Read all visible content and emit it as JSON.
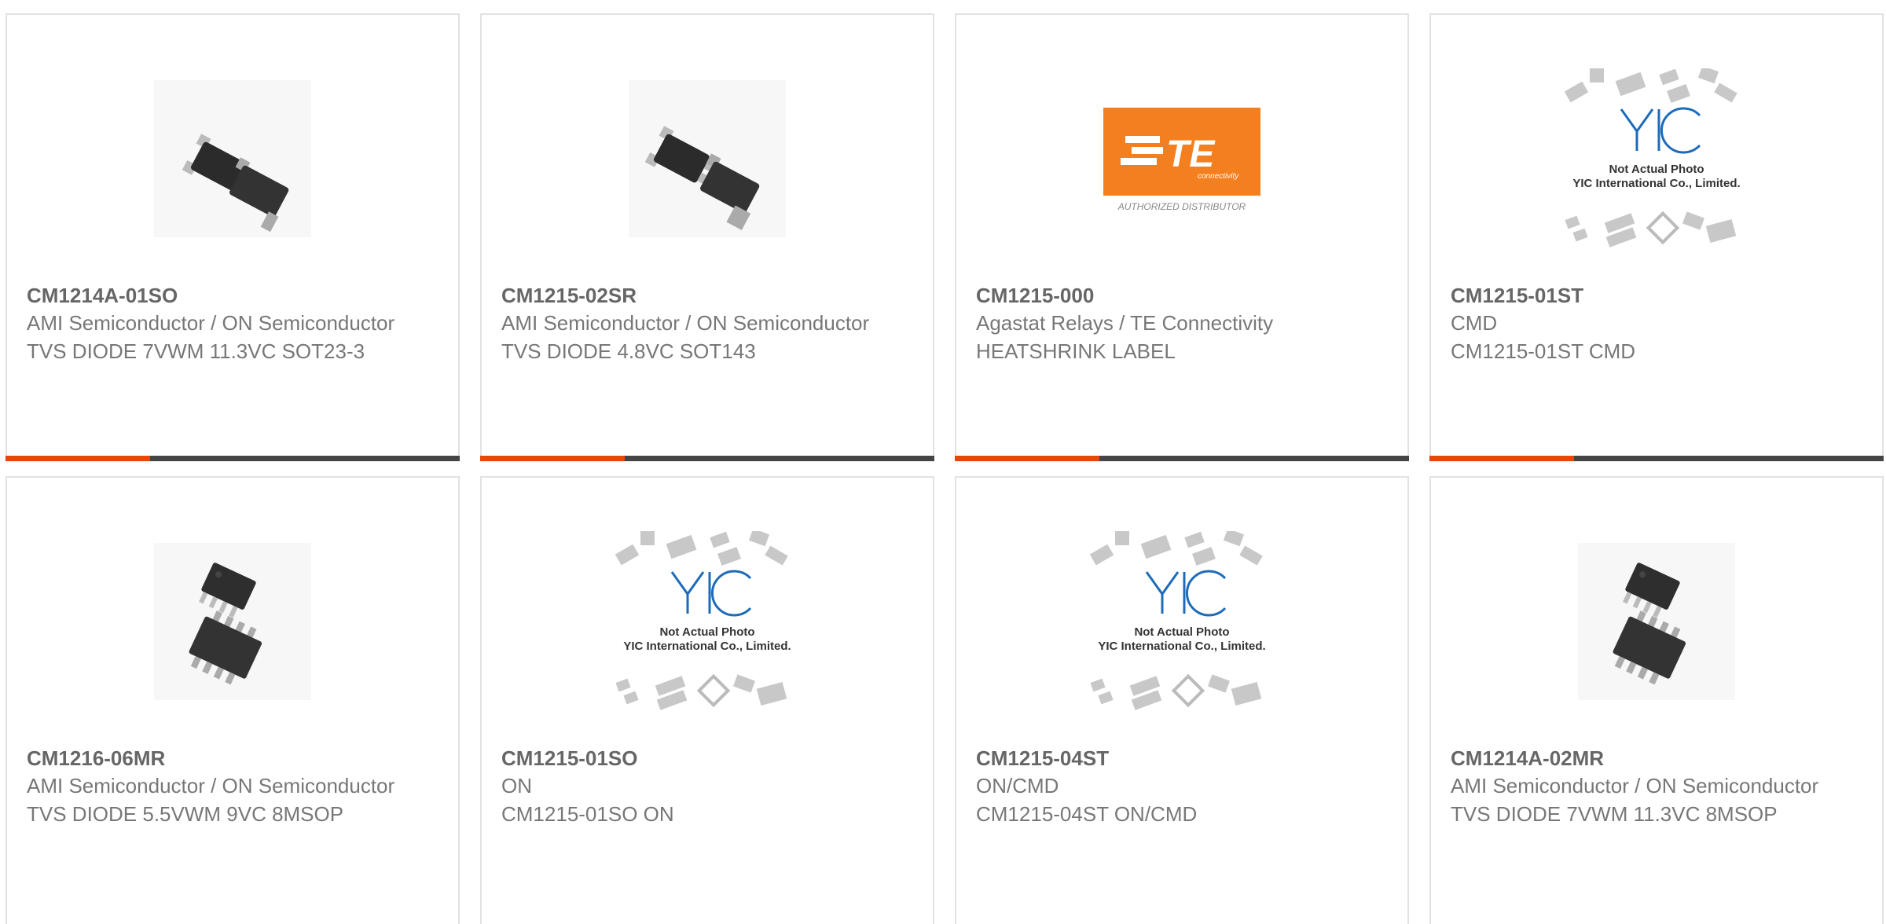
{
  "accent_color": "#e8450f",
  "products": [
    {
      "part": "CM1214A-01SO",
      "manufacturer": "AMI Semiconductor / ON Semiconductor",
      "description": "TVS DIODE 7VWM 11.3VC SOT23-3",
      "image": "sot23-package-icon"
    },
    {
      "part": "CM1215-02SR",
      "manufacturer": "AMI Semiconductor / ON Semiconductor",
      "description": "TVS DIODE 4.8VC SOT143",
      "image": "sot143-package-icon"
    },
    {
      "part": "CM1215-000",
      "manufacturer": "Agastat Relays / TE Connectivity",
      "description": "HEATSHRINK LABEL",
      "image": "te-connectivity-logo",
      "logo_text": "TE",
      "logo_sub": "connectivity",
      "logo_caption": "AUTHORIZED DISTRIBUTOR"
    },
    {
      "part": "CM1215-01ST",
      "manufacturer": "CMD",
      "description": "CM1215-01ST CMD",
      "image": "not-actual-photo-placeholder",
      "placeholder_line1": "Not Actual Photo",
      "placeholder_line2": "YIC International Co., Limited."
    },
    {
      "part": "CM1216-06MR",
      "manufacturer": "AMI Semiconductor / ON Semiconductor",
      "description": "TVS DIODE 5.5VWM 9VC 8MSOP",
      "image": "msop8-package-icon"
    },
    {
      "part": "CM1215-01SO",
      "manufacturer": "ON",
      "description": "CM1215-01SO ON",
      "image": "not-actual-photo-placeholder",
      "placeholder_line1": "Not Actual Photo",
      "placeholder_line2": "YIC International Co., Limited."
    },
    {
      "part": "CM1215-04ST",
      "manufacturer": "ON/CMD",
      "description": "CM1215-04ST ON/CMD",
      "image": "not-actual-photo-placeholder",
      "placeholder_line1": "Not Actual Photo",
      "placeholder_line2": "YIC International Co., Limited."
    },
    {
      "part": "CM1214A-02MR",
      "manufacturer": "AMI Semiconductor / ON Semiconductor",
      "description": "TVS DIODE 7VWM 11.3VC 8MSOP",
      "image": "msop8-package-icon"
    }
  ]
}
